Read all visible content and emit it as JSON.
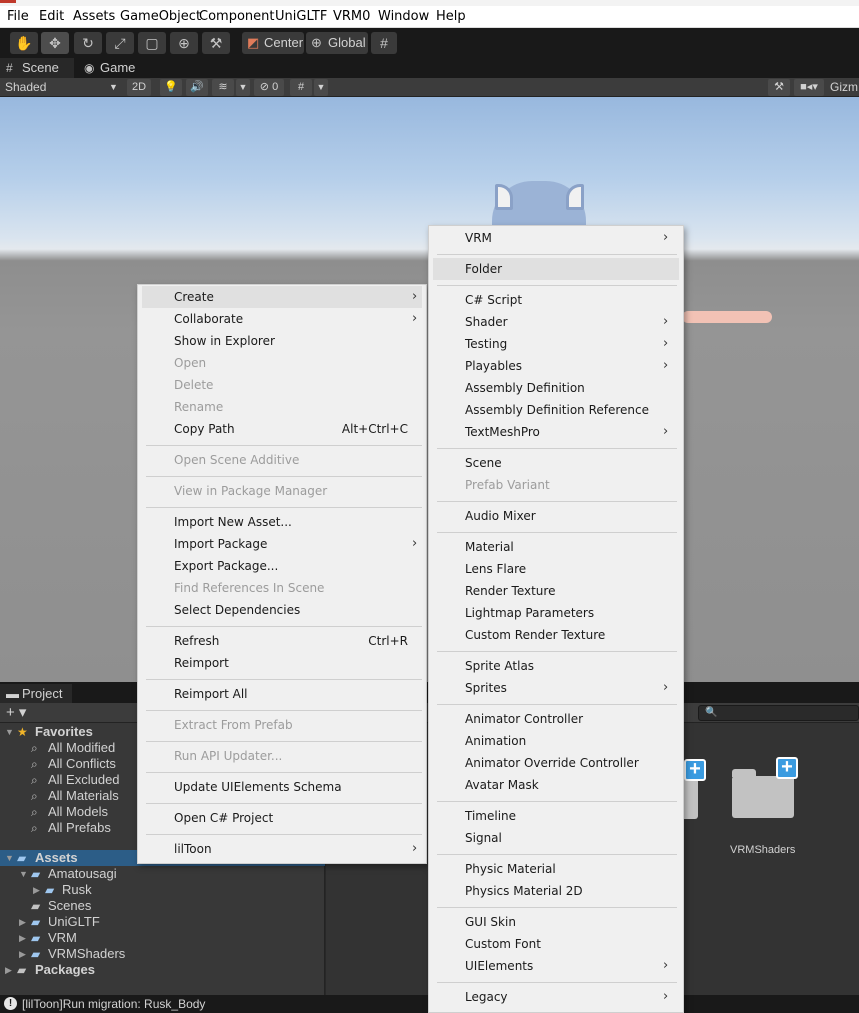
{
  "menubar": [
    "File",
    "Edit",
    "Assets",
    "GameObject",
    "Component",
    "UniGLTF",
    "VRM0",
    "Window",
    "Help"
  ],
  "toolbar": {
    "pivot_label": "Center",
    "space_label": "Global"
  },
  "scene_tabs": {
    "scene": "Scene",
    "game": "Game"
  },
  "scene_bar": {
    "shading_mode": "Shaded",
    "mode_2d": "2D",
    "hidden_count": "0",
    "gizmos_label": "Gizm"
  },
  "project": {
    "tab_label": "Project",
    "tree": [
      {
        "label": "Favorites",
        "bold": true
      },
      {
        "label": "All Modified"
      },
      {
        "label": "All Conflicts"
      },
      {
        "label": "All Excluded"
      },
      {
        "label": "All Materials"
      },
      {
        "label": "All Models"
      },
      {
        "label": "All Prefabs"
      },
      {
        "label": "Assets",
        "bold": true
      },
      {
        "label": "Amatousagi"
      },
      {
        "label": "Rusk"
      },
      {
        "label": "Scenes"
      },
      {
        "label": "UniGLTF"
      },
      {
        "label": "VRM"
      },
      {
        "label": "VRMShaders"
      },
      {
        "label": "Packages",
        "bold": true
      }
    ],
    "grid_items": [
      "VRMShaders"
    ]
  },
  "status": {
    "message": "[lilToon]Run migration: Rusk_Body"
  },
  "context_menu": [
    {
      "label": "Create",
      "submenu": true,
      "highlighted": true
    },
    {
      "label": "Collaborate",
      "submenu": true
    },
    {
      "label": "Show in Explorer"
    },
    {
      "label": "Open",
      "disabled": true
    },
    {
      "label": "Delete",
      "disabled": true
    },
    {
      "label": "Rename",
      "disabled": true
    },
    {
      "label": "Copy Path",
      "shortcut": "Alt+Ctrl+C"
    },
    {
      "label": "Open Scene Additive",
      "disabled": true
    },
    {
      "label": "View in Package Manager",
      "disabled": true
    },
    {
      "label": "Import New Asset..."
    },
    {
      "label": "Import Package",
      "submenu": true
    },
    {
      "label": "Export Package..."
    },
    {
      "label": "Find References In Scene",
      "disabled": true
    },
    {
      "label": "Select Dependencies"
    },
    {
      "label": "Refresh",
      "shortcut": "Ctrl+R"
    },
    {
      "label": "Reimport"
    },
    {
      "label": "Reimport All"
    },
    {
      "label": "Extract From Prefab",
      "disabled": true
    },
    {
      "label": "Run API Updater...",
      "disabled": true
    },
    {
      "label": "Update UIElements Schema"
    },
    {
      "label": "Open C# Project"
    },
    {
      "label": "lilToon",
      "submenu": true
    }
  ],
  "create_submenu": [
    {
      "label": "VRM",
      "submenu": true
    },
    {
      "label": "Folder",
      "highlighted": true
    },
    {
      "label": "C# Script"
    },
    {
      "label": "Shader",
      "submenu": true
    },
    {
      "label": "Testing",
      "submenu": true
    },
    {
      "label": "Playables",
      "submenu": true
    },
    {
      "label": "Assembly Definition"
    },
    {
      "label": "Assembly Definition Reference"
    },
    {
      "label": "TextMeshPro",
      "submenu": true
    },
    {
      "label": "Scene"
    },
    {
      "label": "Prefab Variant",
      "disabled": true
    },
    {
      "label": "Audio Mixer"
    },
    {
      "label": "Material"
    },
    {
      "label": "Lens Flare"
    },
    {
      "label": "Render Texture"
    },
    {
      "label": "Lightmap Parameters"
    },
    {
      "label": "Custom Render Texture"
    },
    {
      "label": "Sprite Atlas"
    },
    {
      "label": "Sprites",
      "submenu": true
    },
    {
      "label": "Animator Controller"
    },
    {
      "label": "Animation"
    },
    {
      "label": "Animator Override Controller"
    },
    {
      "label": "Avatar Mask"
    },
    {
      "label": "Timeline"
    },
    {
      "label": "Signal"
    },
    {
      "label": "Physic Material"
    },
    {
      "label": "Physics Material 2D"
    },
    {
      "label": "GUI Skin"
    },
    {
      "label": "Custom Font"
    },
    {
      "label": "UIElements",
      "submenu": true
    },
    {
      "label": "Legacy",
      "submenu": true
    }
  ],
  "colors": {
    "accent_selected": "#2c5d87",
    "favorites_star": "#f0b429",
    "plus_badge": "#3a9be0"
  }
}
